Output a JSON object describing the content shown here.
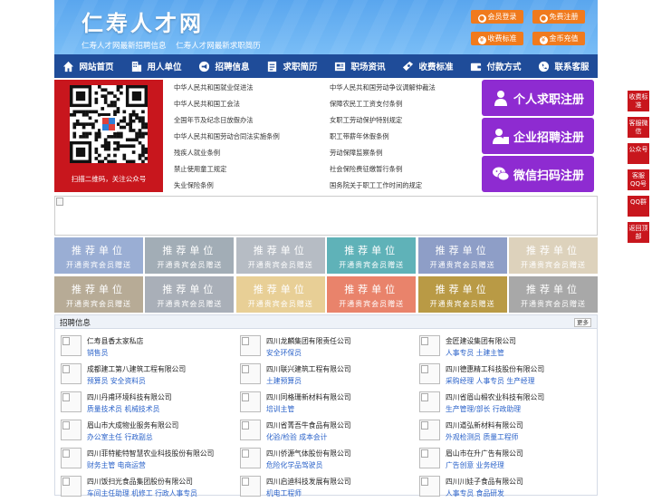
{
  "header": {
    "site_title": "仁寿人才网",
    "subtitle_1": "仁寿人才网最新招聘信息",
    "subtitle_2": "仁寿人才网最新求职简历",
    "buttons": [
      {
        "label": "会员登录",
        "icon": "user-icon"
      },
      {
        "label": "免费注册",
        "icon": "person-icon"
      },
      {
        "label": "收费标准",
        "icon": "money-icon"
      },
      {
        "label": "金币充值",
        "icon": "coin-icon"
      }
    ]
  },
  "nav": {
    "items": [
      {
        "label": "网站首页",
        "icon": "home-icon"
      },
      {
        "label": "用人单位",
        "icon": "building-icon"
      },
      {
        "label": "招聘信息",
        "icon": "megaphone-icon"
      },
      {
        "label": "求职简历",
        "icon": "resume-icon"
      },
      {
        "label": "职场资讯",
        "icon": "news-icon"
      },
      {
        "label": "收费标准",
        "icon": "money-icon"
      },
      {
        "label": "付款方式",
        "icon": "wallet-icon"
      },
      {
        "label": "联系客服",
        "icon": "phone-icon"
      }
    ]
  },
  "qr": {
    "caption": "扫描二维码，关注公众号"
  },
  "laws": {
    "left": [
      "中华人民共和国就业促进法",
      "中华人民共和国工会法",
      "全国年节及纪念日放假办法",
      "中华人民共和国劳动合同法实施条例",
      "残疾人就业条例",
      "禁止使用童工规定",
      "失业保险条例"
    ],
    "right": [
      "中华人民共和国劳动争议调解仲裁法",
      "保障农民工工资支付条例",
      "女职工劳动保护特别规定",
      "职工带薪年休假条例",
      "劳动保障监察条例",
      "社会保险费征缴暂行条例",
      "国务院关于职工工作时间的规定"
    ]
  },
  "register": [
    {
      "label": "个人求职注册",
      "icon": "person-icon"
    },
    {
      "label": "企业招聘注册",
      "icon": "company-user-icon"
    },
    {
      "label": "微信扫码注册",
      "icon": "wechat-icon"
    }
  ],
  "recommend": {
    "title": "推荐单位",
    "sub": "开通贵宾会员赠送",
    "colors": [
      "#9aaed4",
      "#a2adb6",
      "#b6bcc4",
      "#5fb2b8",
      "#8e9ec7",
      "#ddd2bc",
      "#b7ab96",
      "#a9afb8",
      "#e8cf96",
      "#e9836b",
      "#b99a45",
      "#a8a8a8"
    ]
  },
  "jobs": {
    "title": "招聘信息",
    "more": "更多",
    "items": [
      {
        "company": "仁寿县香太家私店",
        "positions": "销售员"
      },
      {
        "company": "四川龙麟集团有限责任公司",
        "positions": "安全环保员"
      },
      {
        "company": "金匠建设集团有限公司",
        "positions": "人事专员  土建主管"
      },
      {
        "company": "成都建工第八建筑工程有限公司",
        "positions": "预算员  安全资料员"
      },
      {
        "company": "四川联兴建筑工程有限公司",
        "positions": "土建预算员"
      },
      {
        "company": "四川德惠精工科技股份有限公司",
        "positions": "采购经理  人事专员  生产经理"
      },
      {
        "company": "四川丹甫环境科技有限公司",
        "positions": "质量技术员  机械技术员"
      },
      {
        "company": "四川同格珊新材料有限公司",
        "positions": "培训主管"
      },
      {
        "company": "四川省眉山椴农业科技有限公司",
        "positions": "生产管理/部长  行政助理"
      },
      {
        "company": "眉山市大成物业服务有限公司",
        "positions": "办公室主任  行政副总"
      },
      {
        "company": "四川省菁吾牛食品有限公司",
        "positions": "化验/检验  成本会计"
      },
      {
        "company": "四川道弘新材料有限公司",
        "positions": "外观检测员  质量工程师"
      },
      {
        "company": "四川菲特能特智慧农业科技股份有限公司",
        "positions": "财务主管  电商运营"
      },
      {
        "company": "四川侨源气体股份有限公司",
        "positions": "危险化学品驾驶员"
      },
      {
        "company": "眉山市在升广告有限公司",
        "positions": "广告创意  业务经理"
      },
      {
        "company": "四川饭扫光食品集团股份有限公司",
        "positions": "车间主任助理  机修工  行政人事专员"
      },
      {
        "company": "四川启迪科技发展有限公司",
        "positions": "机电工程师"
      },
      {
        "company": "四川川娃子食品有限公司",
        "positions": "人事专员  食品研发"
      }
    ]
  },
  "float": [
    {
      "label": "收费标准"
    },
    {
      "label": "客服微信"
    },
    {
      "label": "公众号"
    },
    {
      "label": "客服QQ号"
    },
    {
      "label": "QQ群"
    },
    {
      "label": "返回顶部"
    }
  ]
}
